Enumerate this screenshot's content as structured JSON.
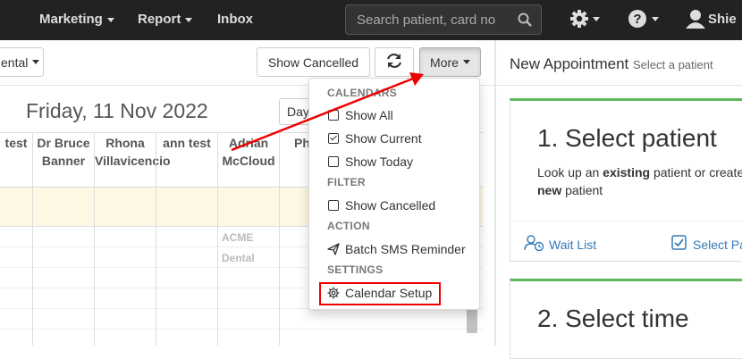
{
  "navbar": {
    "items": [
      {
        "label": "Marketing",
        "has_caret": true
      },
      {
        "label": "Report",
        "has_caret": true
      },
      {
        "label": "Inbox",
        "has_caret": false
      }
    ],
    "search_placeholder": "Search patient, card no",
    "user_name": "Shie",
    "icons": [
      "search-icon",
      "gear-icon",
      "help-icon",
      "user-icon"
    ]
  },
  "toolbar": {
    "dental_dropdown": "ental",
    "show_cancelled": "Show Cancelled",
    "refresh_icon": "refresh-icon",
    "more": "More"
  },
  "calendar": {
    "date": "Friday, 11 Nov 2022",
    "day_button": "Day",
    "columns": [
      {
        "line1": "test",
        "line2": ""
      },
      {
        "line1": "Dr Bruce",
        "line2": "Banner"
      },
      {
        "line1": "Rhona",
        "line2": "Villavicencio"
      },
      {
        "line1": "ann test",
        "line2": ""
      },
      {
        "line1": "Adrian",
        "line2": "McCloud"
      },
      {
        "line1": "Ph",
        "line2": ""
      }
    ],
    "slot_labels": [
      "ACME",
      "Dental"
    ]
  },
  "menu": {
    "sections": [
      {
        "header": "CALENDARS",
        "items": [
          {
            "label": "Show All",
            "icon": "checkbox",
            "checked": false
          },
          {
            "label": "Show Current",
            "icon": "checkbox",
            "checked": true
          },
          {
            "label": "Show Today",
            "icon": "checkbox",
            "checked": false
          }
        ]
      },
      {
        "header": "FILTER",
        "items": [
          {
            "label": "Show Cancelled",
            "icon": "checkbox",
            "checked": false
          }
        ]
      },
      {
        "header": "ACTION",
        "items": [
          {
            "label": "Batch SMS Reminder",
            "icon": "send-icon"
          }
        ]
      },
      {
        "header": "SETTINGS",
        "items": [
          {
            "label": "Calendar Setup",
            "icon": "gear-icon"
          }
        ]
      }
    ]
  },
  "panel": {
    "title": "New Appointment",
    "subtitle": "Select a patient",
    "step1": {
      "heading": "1. Select patient",
      "text_a": "Look up an ",
      "text_b": "existing",
      "text_c": " patient or create",
      "text_d": "new",
      "text_e": " patient"
    },
    "wait_list": "Wait List",
    "select_pa": "Select Pa",
    "step2": {
      "heading": "2. Select time"
    }
  },
  "colors": {
    "navbar": "#222222",
    "accent_green": "#5cb85c",
    "link_blue": "#337ab7",
    "annotation_red": "#e00000",
    "allday_bg": "#fcf8e3"
  }
}
